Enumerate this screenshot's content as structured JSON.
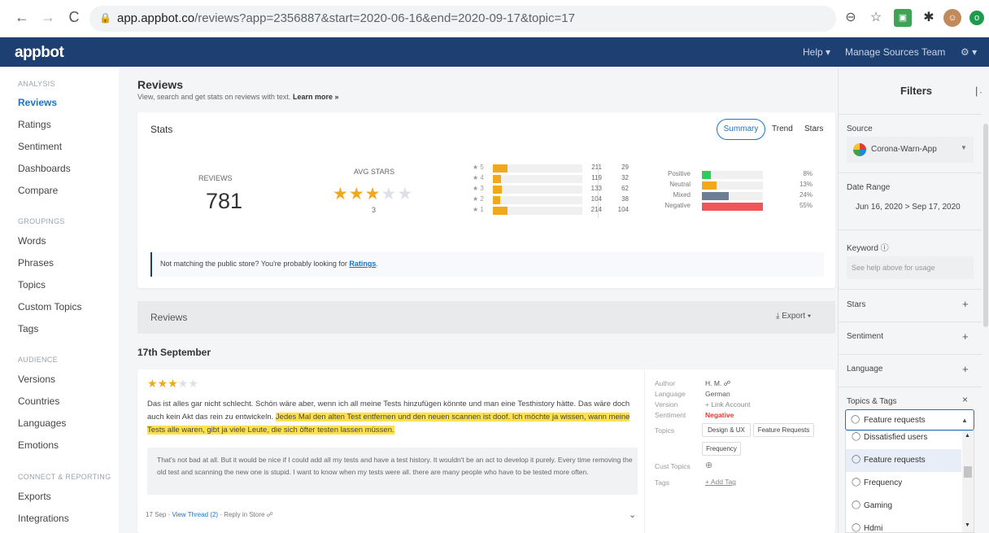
{
  "browser": {
    "url_host": "app.appbot.co",
    "url_path": "/reviews?app=2356887&start=2020-06-16&end=2020-09-17&topic=17"
  },
  "appbar": {
    "logo": "appbot",
    "help": "Help ▾",
    "manage_sources": "Manage Sources",
    "team": "Team",
    "settings": "⚙ ▾"
  },
  "sidebar": {
    "analysis_label": "ANALYSIS",
    "analysis": [
      "Reviews",
      "Ratings",
      "Sentiment",
      "Dashboards",
      "Compare"
    ],
    "groupings_label": "GROUPINGS",
    "groupings": [
      "Words",
      "Phrases",
      "Topics",
      "Custom Topics",
      "Tags"
    ],
    "audience_label": "AUDIENCE",
    "audience": [
      "Versions",
      "Countries",
      "Languages",
      "Emotions"
    ],
    "connect_label": "CONNECT & REPORTING",
    "connect": [
      "Exports",
      "Integrations"
    ]
  },
  "page": {
    "title": "Reviews",
    "subtitle": "View, search and get stats on reviews with text.",
    "learn_more": "Learn more »"
  },
  "stats": {
    "title": "Stats",
    "tabs": {
      "summary": "Summary",
      "trend": "Trend",
      "stars": "Stars"
    },
    "reviews_label": "REVIEWS",
    "reviews_count": "781",
    "avg_label": "AVG STARS",
    "avg_stars_value": 3,
    "avg_value": "3",
    "star_rows": [
      {
        "label": "★ 5",
        "count": "211",
        "count2": "29",
        "fill": 0.16
      },
      {
        "label": "★ 4",
        "count": "119",
        "count2": "32",
        "fill": 0.09
      },
      {
        "label": "★ 3",
        "count": "133",
        "count2": "62",
        "fill": 0.1
      },
      {
        "label": "★ 2",
        "count": "104",
        "count2": "38",
        "fill": 0.08
      },
      {
        "label": "★ 1",
        "count": "214",
        "count2": "104",
        "fill": 0.16
      }
    ],
    "sentiment_rows": [
      {
        "label": "Positive",
        "pct": "8%",
        "fill": 0.08,
        "color": "#2ecc5a"
      },
      {
        "label": "Neutral",
        "pct": "13%",
        "fill": 0.13,
        "color": "#f2a81b"
      },
      {
        "label": "Mixed",
        "pct": "24%",
        "fill": 0.24,
        "color": "#6d7f94"
      },
      {
        "label": "Negative",
        "pct": "55%",
        "fill": 0.55,
        "color": "#f25555"
      }
    ],
    "notice_text": "Not matching the public store? You're probably looking for",
    "notice_link": "Ratings",
    "notice_end": "."
  },
  "reviews_panel": {
    "title": "Reviews",
    "export": "⤓  Export ▾",
    "date_heading": "17th September"
  },
  "review": {
    "stars": 3,
    "text_plain": "Das ist alles gar nicht schlecht. Schön wäre aber, wenn ich all meine Tests hinzufügen könnte und man eine Testhistory hätte. Das wäre doch auch kein Akt das rein zu entwickeln.",
    "text_highlight": "Jedes Mal den alten Test entfernen und den neuen scannen ist doof. Ich möchte ja wissen, wann meine Tests alle waren, gibt ja viele Leute, die sich öfter testen lassen müssen.",
    "translation": "That's not bad at all. But it would be nice if I could add all my tests and have a test history. It wouldn't be an act to develop it purely. Every time removing the old test and scanning the new one is stupid. I want to know when my tests were all. there are many people who have to be tested more often.",
    "footer_date": "17 Sep · ",
    "view_thread": "View Thread (2)",
    "reply": " · Reply in Store ☍",
    "meta": {
      "author_label": "Author",
      "author": "H. M. ☍",
      "language_label": "Language",
      "language": "German",
      "version_label": "Version",
      "version": "+ Link Account",
      "sentiment_label": "Sentiment",
      "sentiment": "Negative",
      "topics_label": "Topics",
      "topics": [
        "Design & UX",
        "Feature Requests",
        "Frequency"
      ],
      "cust_topics_label": "Cust Topics",
      "cust_topics_add": "⊕",
      "tags_label": "Tags",
      "tags_add": "+ Add Tag"
    }
  },
  "filters": {
    "title": "Filters",
    "collapse": "|→",
    "source_label": "Source",
    "source_value": "Corona-Warn-App",
    "date_label": "Date Range",
    "date_value": "Jun 16, 2020   >   Sep 17, 2020",
    "keyword_label": "Keyword ⓘ",
    "keyword_placeholder": "See help above for usage",
    "stars_label": "Stars",
    "sentiment_label": "Sentiment",
    "language_label": "Language",
    "topics_label": "Topics & Tags",
    "topics_clear": "×",
    "topics_selected": "Feature requests",
    "topic_options": [
      "Dissatisfied users",
      "Feature requests",
      "Frequency",
      "Gaming",
      "Hdmi"
    ]
  },
  "colors": {
    "brand": "#1d3f72",
    "accent": "#1a73c8",
    "star": "#f2a81b",
    "negative": "#e53935"
  }
}
